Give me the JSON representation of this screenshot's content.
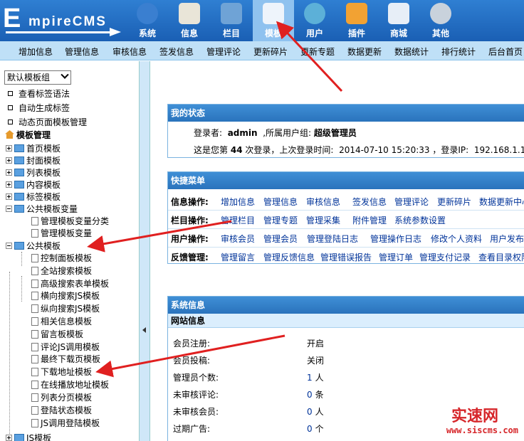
{
  "app": {
    "logo_text": "EmpireCMS",
    "logo_big": "E",
    "logo_rest": "mpireCMS"
  },
  "nav": [
    {
      "label": "系统",
      "icon": "globe-icon",
      "color": "#3a7fd0"
    },
    {
      "label": "信息",
      "icon": "document-edit-icon",
      "color": "#e9e5d8"
    },
    {
      "label": "栏目",
      "icon": "folder-icon",
      "color": "#6fa3d6"
    },
    {
      "label": "模板",
      "icon": "template-window-icon",
      "color": "#eef4fb",
      "active": true
    },
    {
      "label": "用户",
      "icon": "user-icon",
      "color": "#5cb0d8"
    },
    {
      "label": "插件",
      "icon": "tools-icon",
      "color": "#f2a233"
    },
    {
      "label": "商城",
      "icon": "shop-card-icon",
      "color": "#e7eef7"
    },
    {
      "label": "其他",
      "icon": "gear-icon",
      "color": "#c9d2dc"
    }
  ],
  "subnav": [
    "增加信息",
    "管理信息",
    "审核信息",
    "签发信息",
    "管理评论",
    "更新碎片",
    "更新专题",
    "数据更新",
    "数据统计",
    "排行统计",
    "后台首页"
  ],
  "sidebar": {
    "select_value": "默认模板组",
    "links": [
      "查看标签语法",
      "自动生成标签",
      "动态页面模板管理"
    ],
    "root": "模板管理",
    "tree": [
      {
        "label": "首页模板",
        "type": "folder",
        "state": "plus"
      },
      {
        "label": "封面模板",
        "type": "folder",
        "state": "plus"
      },
      {
        "label": "列表模板",
        "type": "folder",
        "state": "plus"
      },
      {
        "label": "内容模板",
        "type": "folder",
        "state": "plus"
      },
      {
        "label": "标签模板",
        "type": "folder",
        "state": "plus"
      },
      {
        "label": "公共模板变量",
        "type": "folder",
        "state": "minus"
      },
      {
        "label": "管理模板变量分类",
        "type": "doc"
      },
      {
        "label": "管理模板变量",
        "type": "doc"
      },
      {
        "label": "公共模板",
        "type": "folder",
        "state": "minus"
      },
      {
        "label": "控制面板模板",
        "type": "doc"
      },
      {
        "label": "全站搜索模板",
        "type": "doc"
      },
      {
        "label": "高级搜索表单模板",
        "type": "doc"
      },
      {
        "label": "横向搜索JS模板",
        "type": "doc"
      },
      {
        "label": "纵向搜索JS模板",
        "type": "doc"
      },
      {
        "label": "相关信息模板",
        "type": "doc"
      },
      {
        "label": "留言板模板",
        "type": "doc"
      },
      {
        "label": "评论JS调用模板",
        "type": "doc"
      },
      {
        "label": "最终下载页模板",
        "type": "doc"
      },
      {
        "label": "下载地址模板",
        "type": "doc"
      },
      {
        "label": "在线播放地址模板",
        "type": "doc"
      },
      {
        "label": "列表分页模板",
        "type": "doc"
      },
      {
        "label": "登陆状态模板",
        "type": "doc"
      },
      {
        "label": "JS调用登陆模板",
        "type": "doc"
      },
      {
        "label": "JS模板",
        "type": "folder",
        "state": "plus"
      }
    ]
  },
  "status": {
    "title": "我的状态",
    "login_prefix": "登录者:",
    "user": "admin",
    "group_prefix": ",所属用户组:",
    "group": "超级管理员",
    "count_prefix": "这是您第",
    "count": "44",
    "count_suffix": "次登录，上次登录时间:",
    "last_time": "2014-07-10 15:20:33",
    "ip_prefix": "，登录IP:",
    "ip": "192.168.1.1"
  },
  "quick": {
    "title": "快捷菜单",
    "rows": [
      {
        "label": "信息操作:",
        "links": [
          "增加信息",
          "管理信息",
          "审核信息",
          "签发信息",
          "管理评论",
          "更新碎片",
          "数据更新中心"
        ]
      },
      {
        "label": "栏目操作:",
        "links": [
          "管理栏目",
          "管理专题",
          "管理采集",
          "附件管理",
          "系统参数设置"
        ]
      },
      {
        "label": "用户操作:",
        "links": [
          "审核会员",
          "管理会员",
          "管理登陆日志",
          "管理操作日志",
          "修改个人资料",
          "用户发布统"
        ]
      },
      {
        "label": "反馈管理:",
        "links": [
          "管理留言",
          "管理反馈信息",
          "管理错误报告",
          "管理订单",
          "管理支付记录",
          "查看目录权限"
        ]
      }
    ]
  },
  "sysinfo": {
    "title": "系统信息",
    "subtitle": "网站信息",
    "rows": [
      {
        "key": "会员注册:",
        "value": "开启",
        "unit": ""
      },
      {
        "key": "会员投稿:",
        "value": "关闭",
        "unit": ""
      },
      {
        "key": "管理员个数:",
        "value": "1",
        "unit": "人"
      },
      {
        "key": "未审核评论:",
        "value": "0",
        "unit": "条"
      },
      {
        "key": "未审核会员:",
        "value": "0",
        "unit": "人"
      },
      {
        "key": "过期广告:",
        "value": "0",
        "unit": "个"
      }
    ]
  },
  "watermark": {
    "title": "实速网",
    "url": "www.siscms.com"
  },
  "colors": {
    "topbar": "#1a5fb4",
    "subbar": "#bfe0f7",
    "panel_head": "#2a73bc",
    "arrow": "#e02020"
  }
}
